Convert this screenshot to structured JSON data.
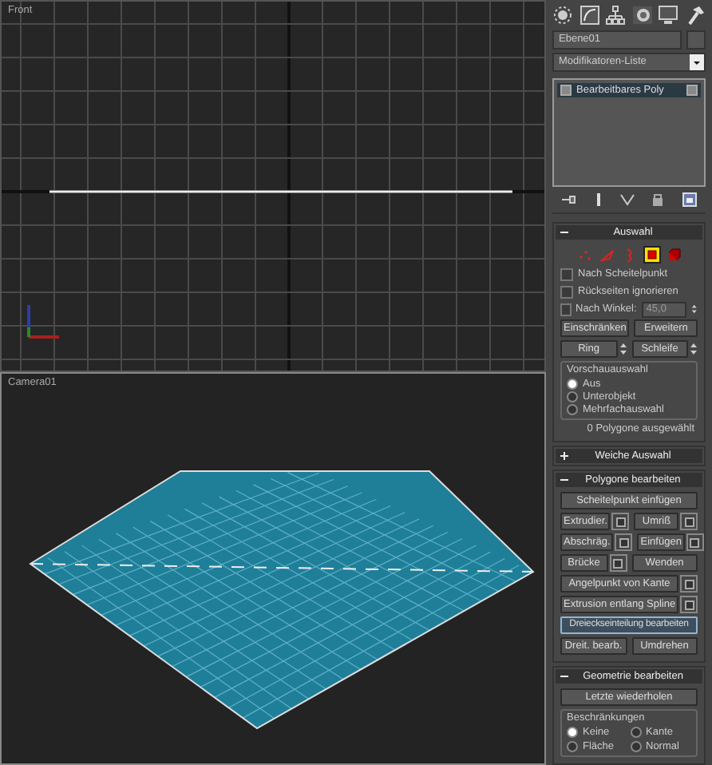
{
  "viewports": [
    {
      "kind": "front",
      "label": "Front"
    },
    {
      "kind": "camera",
      "label": "Camera01"
    }
  ],
  "command_panel": {
    "object_name": "Ebene01",
    "modifier_list": "Modifikatoren-Liste",
    "stack": [
      {
        "label": "Bearbeitbares Poly",
        "selected": true
      }
    ],
    "rollouts": [
      {
        "title": "Auswahl",
        "expanded": true,
        "items": [
          {
            "kind": "levels",
            "levels": [
              {
                "kind": "vertex",
                "selected": false
              },
              {
                "kind": "edge",
                "selected": false
              },
              {
                "kind": "border",
                "selected": false
              },
              {
                "kind": "polygon",
                "selected": true
              },
              {
                "kind": "element",
                "selected": false
              }
            ]
          },
          {
            "kind": "checkbox",
            "label": "Nach Scheitelpunkt",
            "checked": false
          },
          {
            "kind": "checkbox",
            "label": "Rückseiten ignorieren",
            "checked": false
          },
          {
            "kind": "checkbox",
            "label": "Nach Winkel:",
            "checked": false,
            "value": "45,0"
          },
          {
            "kind": "buttons",
            "buttons": [
              {
                "label": "Einschränken",
                "active": false
              },
              {
                "label": "Erweitern",
                "active": false
              }
            ]
          },
          {
            "kind": "buttons",
            "buttons": [
              {
                "label": "Ring",
                "active": false,
                "spinner": true
              },
              {
                "label": "Schleife",
                "active": false,
                "spinner": true
              }
            ]
          },
          {
            "kind": "radio_list",
            "title": "Vorschauauswahl",
            "options": [
              {
                "label": "Aus",
                "selected": true
              },
              {
                "label": "Unterobjekt",
                "selected": false
              },
              {
                "label": "Mehrfachauswahl",
                "selected": false
              }
            ]
          },
          {
            "kind": "status",
            "text": "0 Polygone ausgewählt"
          }
        ]
      },
      {
        "title": "Weiche Auswahl",
        "expanded": false
      },
      {
        "title": "Polygone bearbeiten",
        "expanded": true,
        "items": [
          {
            "kind": "buttons",
            "buttons": [
              {
                "label": "Scheitelpunkt einfügen",
                "active": false
              }
            ]
          },
          {
            "kind": "buttons",
            "buttons": [
              {
                "label": "Extrudier.",
                "active": false,
                "settings": true
              },
              {
                "label": "Umriß",
                "active": false,
                "settings": true
              }
            ]
          },
          {
            "kind": "buttons",
            "buttons": [
              {
                "label": "Abschräg.",
                "active": false,
                "settings": true
              },
              {
                "label": "Einfügen",
                "active": false,
                "settings": true
              }
            ]
          },
          {
            "kind": "buttons",
            "buttons": [
              {
                "label": "Brücke",
                "active": false,
                "settings": true
              },
              {
                "label": "Wenden",
                "active": false
              }
            ]
          },
          {
            "kind": "buttons",
            "buttons": [
              {
                "label": "Angelpunkt von Kante",
                "active": false,
                "settings": true
              }
            ]
          },
          {
            "kind": "buttons",
            "buttons": [
              {
                "label": "Extrusion entlang Spline",
                "active": false,
                "settings": true
              }
            ]
          },
          {
            "kind": "buttons",
            "buttons": [
              {
                "label": "Dreieckseinteilung bearbeiten",
                "active": true
              }
            ]
          },
          {
            "kind": "buttons",
            "buttons": [
              {
                "label": "Dreit. bearb.",
                "active": false
              },
              {
                "label": "Umdrehen",
                "active": false
              }
            ]
          }
        ]
      },
      {
        "title": "Geometrie bearbeiten",
        "expanded": true,
        "items": [
          {
            "kind": "buttons",
            "buttons": [
              {
                "label": "Letzte wiederholen",
                "active": false
              }
            ]
          },
          {
            "kind": "radio_grid",
            "title": "Beschränkungen",
            "options": [
              {
                "label": "Keine",
                "selected": true
              },
              {
                "label": "Kante",
                "selected": false
              },
              {
                "label": "Fläche",
                "selected": false
              },
              {
                "label": "Normal",
                "selected": false
              }
            ]
          }
        ]
      }
    ]
  }
}
